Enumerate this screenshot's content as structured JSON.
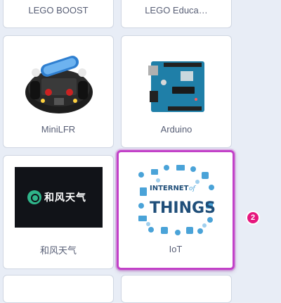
{
  "extensions": [
    {
      "label": "LEGO BOOST"
    },
    {
      "label": "LEGO Educa…"
    },
    {
      "label": "MiniLFR",
      "thumb_icon": "robot-car-icon"
    },
    {
      "label": "Arduino",
      "thumb_icon": "arduino-board-icon"
    },
    {
      "label": "和风天气",
      "thumb_icon": "qweather-logo-icon",
      "logo_text": "和风天气"
    },
    {
      "label": "IoT",
      "thumb_icon": "internet-of-things-icon",
      "art_line1": "INTERNET",
      "art_of": "of",
      "art_line2": "THINGS",
      "selected": true
    }
  ],
  "step_badge": "2",
  "colors": {
    "selection_outline": "#c241c8",
    "badge": "#e6177d",
    "page_background": "#e8edf6"
  }
}
